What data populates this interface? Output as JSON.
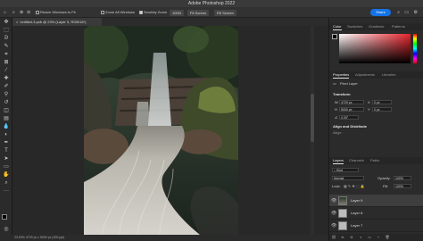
{
  "window": {
    "title": "Adobe Photoshop 2022"
  },
  "options_bar": {
    "resize_windows": "Resize Windows to Fit",
    "zoom_all": "Zoom All Windows",
    "scrubby_zoom": "Scrubby Zoom",
    "pct_button": "100%",
    "fit_screen": "Fit Screen",
    "fill_screen": "Fill Screen",
    "share": "Share"
  },
  "document": {
    "tab_title": "Untitled-3.psb @ 23% (Layer 9, RGB/16*)",
    "status": "23.03%    4729 px x 5000 px (300 ppi)"
  },
  "color_panel": {
    "tabs": [
      "Color",
      "Swatches",
      "Gradients",
      "Patterns"
    ]
  },
  "properties_panel": {
    "tabs": [
      "Properties",
      "Adjustments",
      "Libraries"
    ],
    "kind": "Pixel Layer",
    "transform_label": "Transform",
    "w_label": "W",
    "w_value": "4729 px",
    "h_label": "H",
    "h_value": "5000 px",
    "x_label": "X",
    "x_value": "0 px",
    "y_label": "Y",
    "y_value": "0 px",
    "angle_value": "0.00°",
    "align_label": "Align and Distribute",
    "align_sub": "Align:"
  },
  "layers_panel": {
    "tabs": [
      "Layers",
      "Channels",
      "Paths"
    ],
    "filter": "Kind",
    "blend_mode": "Normal",
    "opacity_label": "Opacity:",
    "opacity_value": "100%",
    "lock_label": "Lock:",
    "fill_label": "Fill:",
    "fill_value": "100%",
    "layers": [
      {
        "name": "Layer 9",
        "selected": true
      },
      {
        "name": "Layer 8",
        "selected": false
      },
      {
        "name": "Layer 7",
        "selected": false
      }
    ]
  },
  "colors": {
    "accent": "#1473e6",
    "panel_bg": "#2b2b2b"
  }
}
